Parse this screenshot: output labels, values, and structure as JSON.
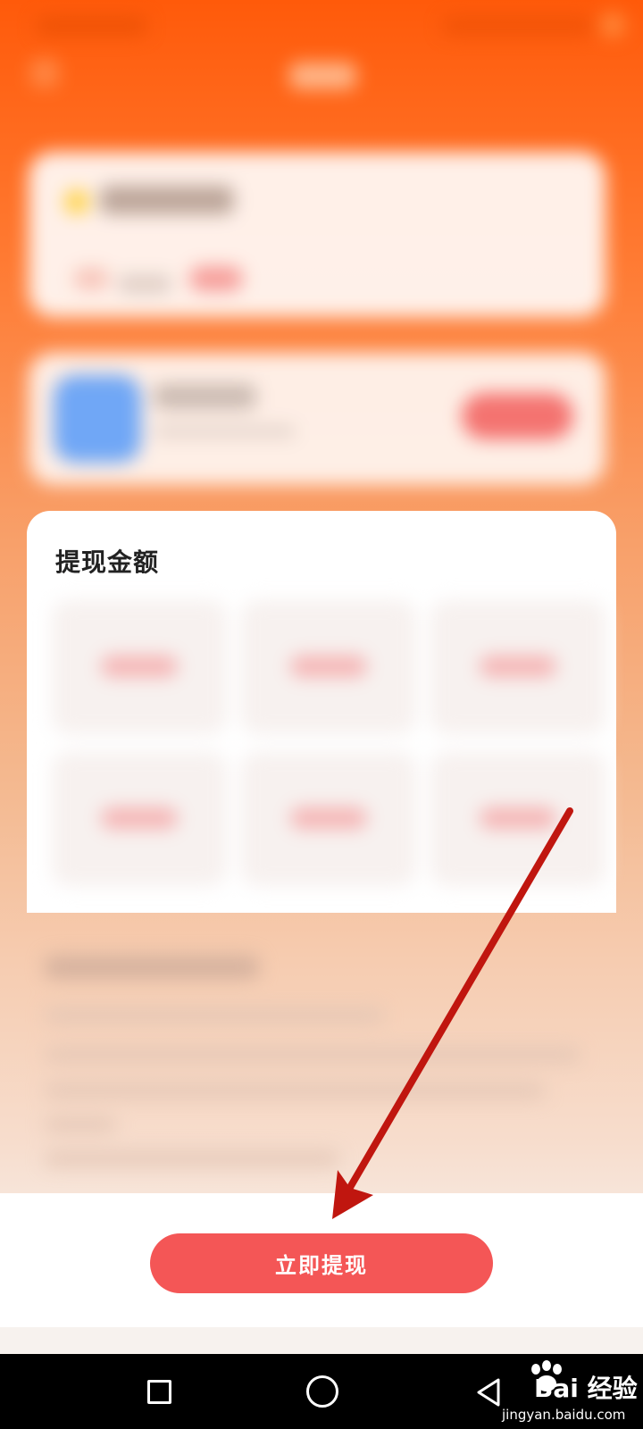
{
  "withdraw_panel": {
    "title": "提现金额"
  },
  "amount_options_count": 6,
  "bottom_bar": {
    "primary_button_label": "立即提现"
  },
  "system_nav": {
    "items": [
      "recent-apps",
      "home",
      "back"
    ]
  },
  "watermark": {
    "brand": "Bai 经验",
    "site": "jingyan.baidu.com"
  },
  "colors": {
    "header_orange": "#ff5a0a",
    "button_red": "#f45656",
    "annotation_arrow": "#c0160f"
  }
}
